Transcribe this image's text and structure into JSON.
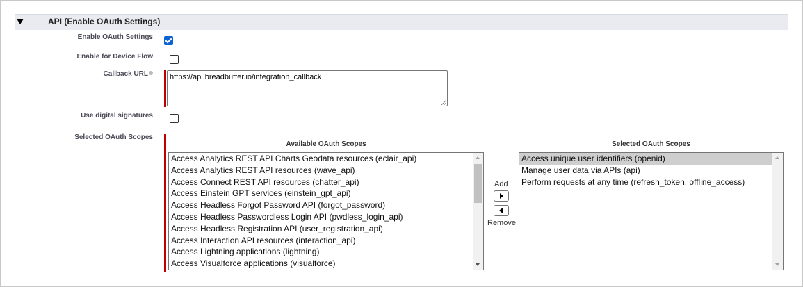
{
  "section": {
    "title": "API (Enable OAuth Settings)",
    "collapse_icon": "triangle-down-icon"
  },
  "fields": {
    "enable_oauth": {
      "label": "Enable OAuth Settings",
      "checked": true
    },
    "device_flow": {
      "label": "Enable for Device Flow",
      "checked": false
    },
    "callback_url": {
      "label": "Callback URL",
      "value": "https://api.breadbutter.io/integration_callback",
      "help_icon": "info-icon"
    },
    "digital_signatures": {
      "label": "Use digital signatures",
      "checked": false
    },
    "selected_scopes": {
      "label": "Selected OAuth Scopes"
    }
  },
  "scopes": {
    "available_title": "Available OAuth Scopes",
    "selected_title": "Selected OAuth Scopes",
    "available": [
      "Access Analytics REST API Charts Geodata resources (eclair_api)",
      "Access Analytics REST API resources (wave_api)",
      "Access Connect REST API resources (chatter_api)",
      "Access Einstein GPT services (einstein_gpt_api)",
      "Access Headless Forgot Password API (forgot_password)",
      "Access Headless Passwordless Login API (pwdless_login_api)",
      "Access Headless Registration API (user_registration_api)",
      "Access Interaction API resources (interaction_api)",
      "Access Lightning applications (lightning)",
      "Access Visualforce applications (visualforce)"
    ],
    "selected": [
      "Access unique user identifiers (openid)",
      "Manage user data via APIs (api)",
      "Perform requests at any time (refresh_token, offline_access)"
    ],
    "add_label": "Add",
    "remove_label": "Remove",
    "accent_required": "#c00000",
    "checkbox_color": "#0a63d1"
  }
}
